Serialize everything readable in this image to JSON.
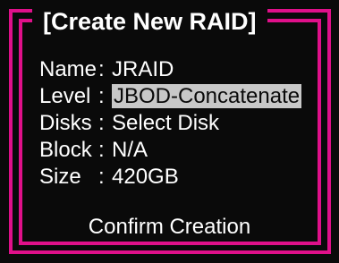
{
  "dialog": {
    "title": "[Create New RAID]",
    "fields": [
      {
        "label": "Name",
        "separator": ":",
        "value": "JRAID",
        "selected": false
      },
      {
        "label": "Level",
        "separator": ":",
        "value": "JBOD-Concatenate",
        "selected": true
      },
      {
        "label": "Disks",
        "separator": ":",
        "value": "Select Disk",
        "selected": false
      },
      {
        "label": "Block",
        "separator": ":",
        "value": "N/A",
        "selected": false
      },
      {
        "label": "Size",
        "separator": ":",
        "value": "420GB",
        "selected": false
      }
    ],
    "confirm_label": "Confirm Creation"
  },
  "colors": {
    "background": "#0a0a0a",
    "frame": "#e0108a",
    "text": "#ffffff",
    "highlight": "#c8c8c8"
  }
}
